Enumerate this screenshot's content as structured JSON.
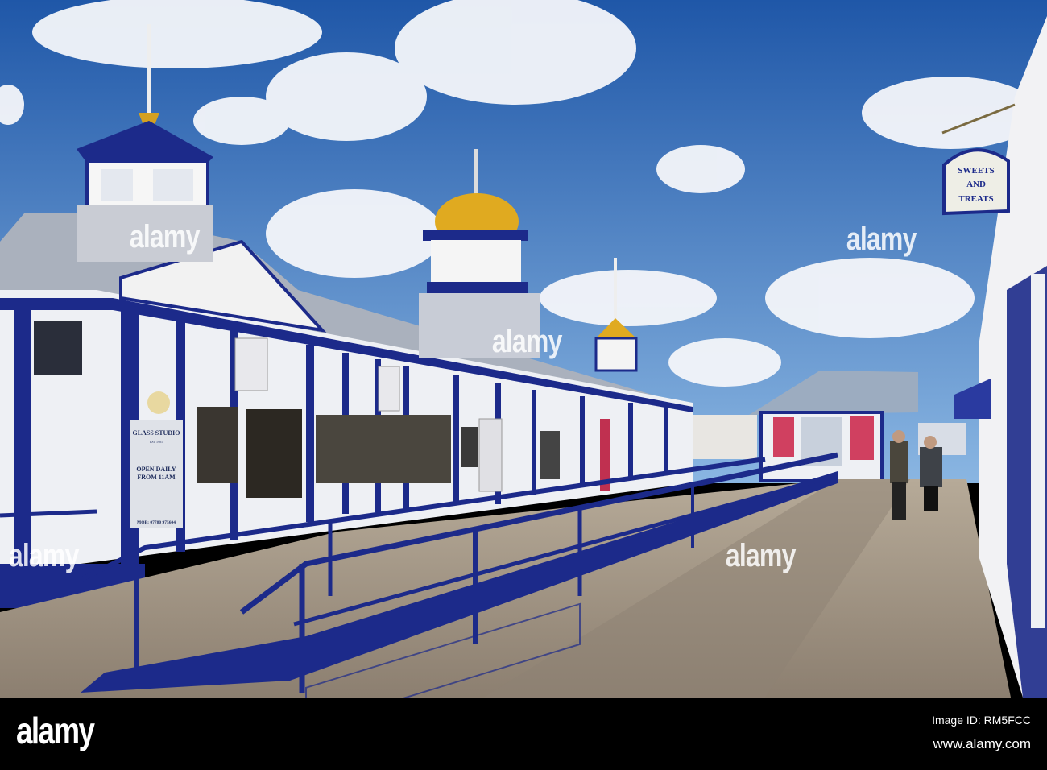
{
  "signs": {
    "glass_studio": {
      "title": "GLASS STUDIO",
      "subtitle": "EST 1981",
      "hours_1": "OPEN DAILY",
      "hours_2": "FROM 11AM",
      "phone": "MOB: 07780 975604"
    },
    "sweets": {
      "line1": "SWEETS",
      "line2": "AND",
      "line3": "TREATS"
    }
  },
  "watermark": "alamy",
  "footer": {
    "logo": "alamy",
    "image_id": "Image ID: RM5FCC",
    "url": "www.alamy.com"
  },
  "colors": {
    "sky_top": "#1f57a8",
    "sky_bottom": "#7aaee0",
    "pier_blue": "#1c2a8a",
    "boards": "#a39686",
    "building_white": "#eef0f4"
  }
}
